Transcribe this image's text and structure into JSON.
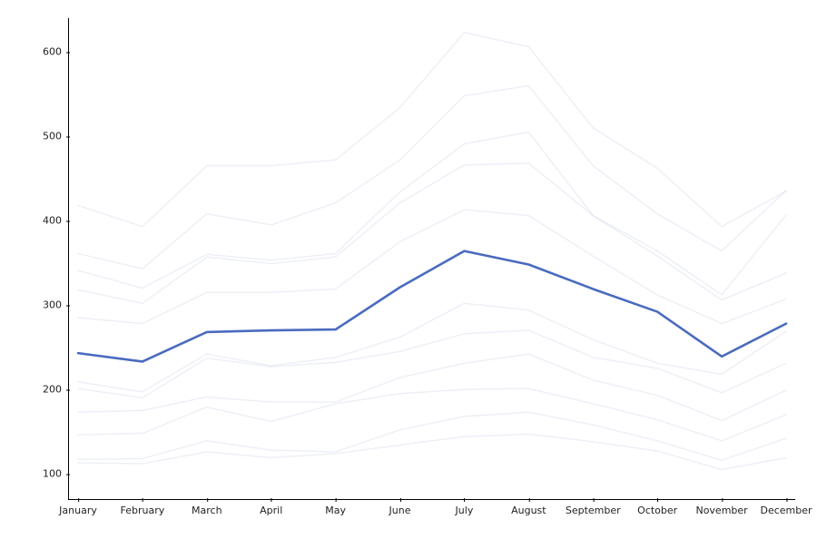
{
  "chart_data": {
    "type": "line",
    "categories": [
      "January",
      "February",
      "March",
      "April",
      "May",
      "June",
      "July",
      "August",
      "September",
      "October",
      "November",
      "December"
    ],
    "series": [
      {
        "name": "bg1",
        "role": "background",
        "values": [
          113,
          112,
          126,
          119,
          124,
          134,
          144,
          147,
          138,
          127,
          105,
          119
        ]
      },
      {
        "name": "bg2",
        "role": "background",
        "values": [
          117,
          118,
          139,
          128,
          126,
          152,
          168,
          173,
          158,
          139,
          116,
          142
        ]
      },
      {
        "name": "bg3",
        "role": "background",
        "values": [
          146,
          148,
          179,
          162,
          183,
          195,
          200,
          201,
          183,
          164,
          139,
          170
        ]
      },
      {
        "name": "bg4",
        "role": "background",
        "values": [
          173,
          175,
          191,
          185,
          185,
          214,
          231,
          242,
          211,
          193,
          163,
          199
        ]
      },
      {
        "name": "bg5",
        "role": "background",
        "values": [
          201,
          190,
          237,
          227,
          232,
          245,
          266,
          270,
          238,
          225,
          196,
          231
        ]
      },
      {
        "name": "bg6",
        "role": "background",
        "values": [
          209,
          197,
          242,
          228,
          238,
          262,
          302,
          294,
          259,
          231,
          218,
          269
        ]
      },
      {
        "name": "bg7",
        "role": "background",
        "values": [
          285,
          278,
          315,
          315,
          319,
          375,
          413,
          406,
          358,
          312,
          278,
          307
        ]
      },
      {
        "name": "bg8",
        "role": "background",
        "values": [
          318,
          302,
          357,
          349,
          357,
          421,
          466,
          468,
          406,
          358,
          306,
          338
        ]
      },
      {
        "name": "bg9",
        "role": "background",
        "values": [
          341,
          320,
          360,
          353,
          361,
          434,
          491,
          505,
          406,
          364,
          312,
          407
        ]
      },
      {
        "name": "bg10",
        "role": "background",
        "values": [
          361,
          343,
          408,
          395,
          421,
          472,
          548,
          560,
          465,
          408,
          364,
          436
        ]
      },
      {
        "name": "bg11",
        "role": "background",
        "values": [
          418,
          393,
          465,
          465,
          472,
          534,
          623,
          606,
          510,
          462,
          393,
          435
        ]
      },
      {
        "name": "highlight",
        "role": "highlight",
        "values": [
          243,
          233,
          268,
          270,
          271,
          321,
          364,
          348,
          319,
          292,
          239,
          278
        ]
      }
    ],
    "ylim": [
      70,
      640
    ],
    "yticks": [
      100,
      200,
      300,
      400,
      500,
      600
    ],
    "title": "",
    "xlabel": "",
    "ylabel": ""
  },
  "xtick_labels": {
    "t0": "January",
    "t1": "February",
    "t2": "March",
    "t3": "April",
    "t4": "May",
    "t5": "June",
    "t6": "July",
    "t7": "August",
    "t8": "September",
    "t9": "October",
    "t10": "November",
    "t11": "December"
  },
  "ytick_labels": {
    "y100": "100",
    "y200": "200",
    "y300": "300",
    "y400": "400",
    "y500": "500",
    "y600": "600"
  }
}
